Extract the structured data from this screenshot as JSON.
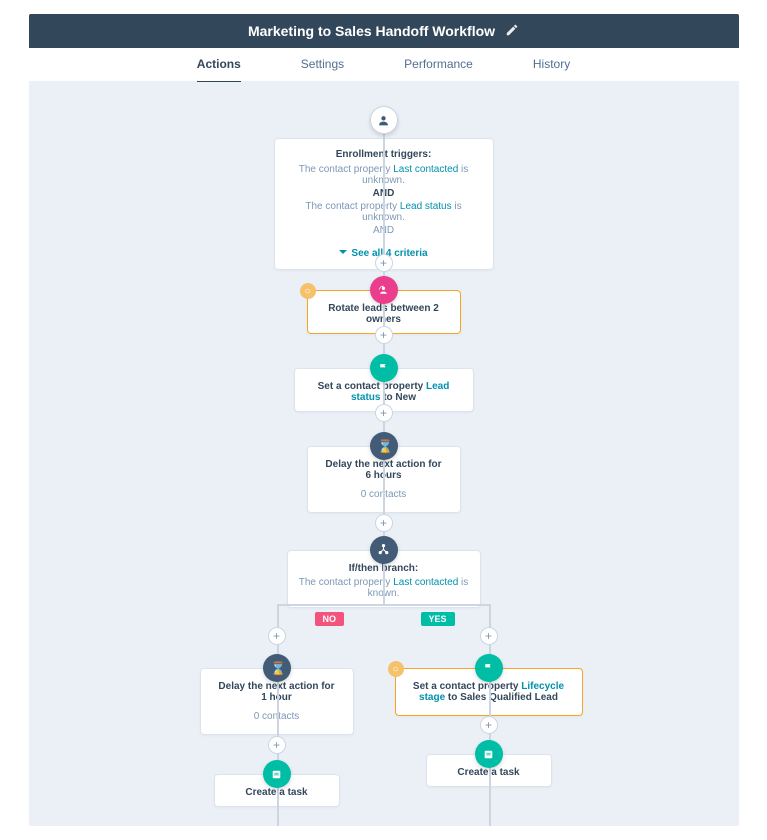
{
  "header": {
    "title": "Marketing to Sales Handoff Workflow"
  },
  "tabs": {
    "actions": "Actions",
    "settings": "Settings",
    "performance": "Performance",
    "history": "History"
  },
  "trigger": {
    "heading": "Enrollment triggers:",
    "line1_a": "The contact property ",
    "line1_link": "Last contacted",
    "line1_b": " is unknown.",
    "and": "AND",
    "line2_a": "The contact property ",
    "line2_link": "Lead status",
    "line2_b": " is unknown.",
    "and2": "AND",
    "see_all": "See all 4 criteria"
  },
  "rotate": {
    "text": "Rotate leads between 2 owners"
  },
  "setprop": {
    "prefix": "Set a contact property ",
    "link": "Lead status",
    "suffix": " to New"
  },
  "delay1": {
    "line1": "Delay the next action for",
    "line2": "6 hours",
    "contacts": "0 contacts"
  },
  "branch": {
    "heading": "If/then branch:",
    "line_a": "The contact property ",
    "line_link": "Last contacted",
    "line_b": " is known."
  },
  "labels": {
    "no": "NO",
    "yes": "YES"
  },
  "delay2": {
    "line1": "Delay the next action for",
    "line2": "1 hour",
    "contacts": "0 contacts"
  },
  "setprop2": {
    "prefix": "Set a contact property ",
    "link": "Lifecycle stage",
    "suffix": " to Sales Qualified Lead"
  },
  "task1": {
    "text": "Create a task"
  },
  "task2": {
    "text": "Create a task"
  }
}
